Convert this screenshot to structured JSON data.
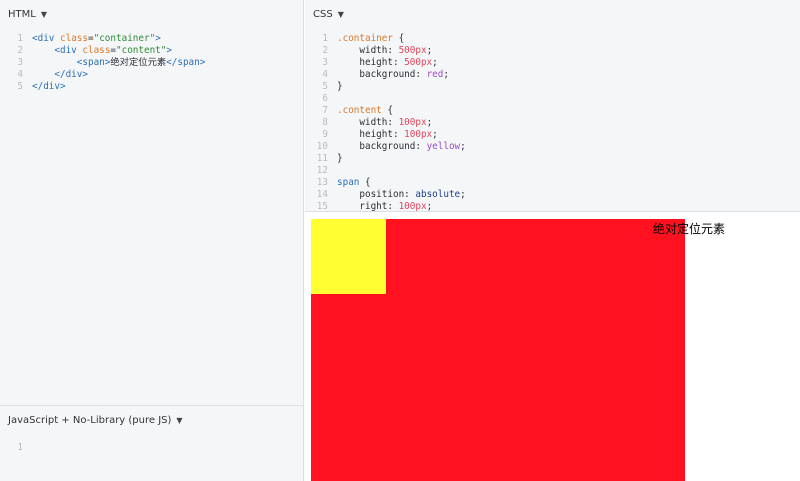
{
  "panes": {
    "html": {
      "title": "HTML",
      "lines": [
        {
          "n": "1",
          "t": [
            [
              "tag",
              "<div "
            ],
            [
              "attr",
              "class"
            ],
            [
              "plain",
              "="
            ],
            [
              "str",
              "\"container\""
            ],
            [
              "tag",
              ">"
            ]
          ]
        },
        {
          "n": "2",
          "t": [
            [
              "plain",
              "    "
            ],
            [
              "tag",
              "<div "
            ],
            [
              "attr",
              "class"
            ],
            [
              "plain",
              "="
            ],
            [
              "str",
              "\"content\""
            ],
            [
              "tag",
              ">"
            ]
          ]
        },
        {
          "n": "3",
          "t": [
            [
              "plain",
              "        "
            ],
            [
              "tag",
              "<span>"
            ],
            [
              "plain",
              "绝对定位元素"
            ],
            [
              "tag",
              "</span>"
            ]
          ]
        },
        {
          "n": "4",
          "t": [
            [
              "plain",
              "    "
            ],
            [
              "tag",
              "</div>"
            ]
          ]
        },
        {
          "n": "5",
          "t": [
            [
              "tag",
              "</div>"
            ]
          ]
        }
      ]
    },
    "css": {
      "title": "CSS",
      "lines": [
        {
          "n": "1",
          "t": [
            [
              "sel",
              ".container"
            ],
            [
              "plain",
              " {"
            ]
          ]
        },
        {
          "n": "2",
          "t": [
            [
              "plain",
              "    width: "
            ],
            [
              "num",
              "500px"
            ],
            [
              "plain",
              ";"
            ]
          ]
        },
        {
          "n": "3",
          "t": [
            [
              "plain",
              "    height: "
            ],
            [
              "num",
              "500px"
            ],
            [
              "plain",
              ";"
            ]
          ]
        },
        {
          "n": "4",
          "t": [
            [
              "plain",
              "    background: "
            ],
            [
              "kw",
              "red"
            ],
            [
              "plain",
              ";"
            ]
          ]
        },
        {
          "n": "5",
          "t": [
            [
              "plain",
              "}"
            ]
          ]
        },
        {
          "n": "6",
          "t": []
        },
        {
          "n": "7",
          "t": [
            [
              "sel",
              ".content"
            ],
            [
              "plain",
              " {"
            ]
          ]
        },
        {
          "n": "8",
          "t": [
            [
              "plain",
              "    width: "
            ],
            [
              "num",
              "100px"
            ],
            [
              "plain",
              ";"
            ]
          ]
        },
        {
          "n": "9",
          "t": [
            [
              "plain",
              "    height: "
            ],
            [
              "num",
              "100px"
            ],
            [
              "plain",
              ";"
            ]
          ]
        },
        {
          "n": "10",
          "t": [
            [
              "plain",
              "    background: "
            ],
            [
              "kw",
              "yellow"
            ],
            [
              "plain",
              ";"
            ]
          ]
        },
        {
          "n": "11",
          "t": [
            [
              "plain",
              "}"
            ]
          ]
        },
        {
          "n": "12",
          "t": []
        },
        {
          "n": "13",
          "t": [
            [
              "tag",
              "span"
            ],
            [
              "plain",
              " {"
            ]
          ]
        },
        {
          "n": "14",
          "t": [
            [
              "plain",
              "    position: "
            ],
            [
              "abs",
              "absolute"
            ],
            [
              "plain",
              ";"
            ]
          ]
        },
        {
          "n": "15",
          "t": [
            [
              "plain",
              "    right: "
            ],
            [
              "num",
              "100px"
            ],
            [
              "plain",
              ";"
            ]
          ]
        }
      ]
    },
    "js": {
      "title": "JavaScript + No-Library (pure JS)",
      "lines": [
        {
          "n": "1",
          "t": []
        }
      ]
    }
  },
  "preview": {
    "span_text": "绝对定位元素",
    "container_color": "#ff111f",
    "content_color": "#ffff33"
  }
}
